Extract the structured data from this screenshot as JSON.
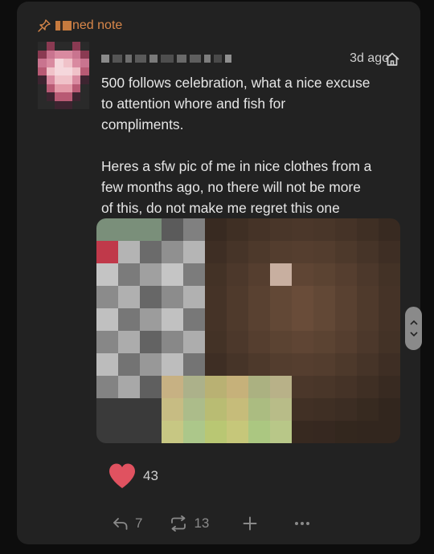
{
  "post": {
    "pinned_label": "ned note",
    "timestamp": "3d ago",
    "body": "500 follows celebration, what a nice excuse\nto attention whore and fish for\ncompliments.\n\nHeres a sfw pic of me in nice clothes from a\nfew months ago, no there will not be more\nof this, do not make me regret this one",
    "likes": "43",
    "replies": "7",
    "reposts": "13"
  },
  "icons": {
    "pin": "pin-icon",
    "home": "home-icon",
    "heart": "heart-icon",
    "reply": "reply-icon",
    "repost": "repost-icon",
    "add": "plus-icon",
    "more": "more-icon",
    "scroll": "scroll-handle-icon"
  },
  "colors": {
    "card": "#222222",
    "accent": "#d9874a",
    "heart": "#e05260",
    "text": "#e6e6e6",
    "muted": "#8a8a8a"
  }
}
